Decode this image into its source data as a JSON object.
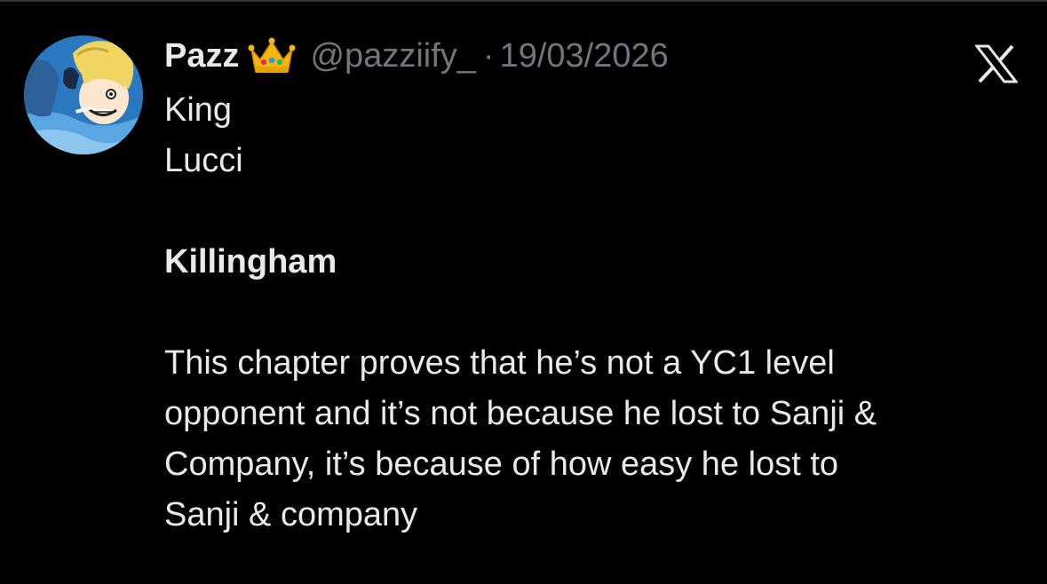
{
  "author": {
    "display_name": "Pazz",
    "badge_icon": "crown-emoji",
    "handle": "@pazziify_",
    "separator": "·",
    "date": "19/03/2026",
    "avatar_desc": "anime-character-avatar"
  },
  "platform": {
    "logo_icon": "x-logo-icon"
  },
  "tweet": {
    "line1": "King",
    "line2": "Lucci",
    "line3": "",
    "line4": "Killingham",
    "line5": "",
    "line6": "This chapter proves that he’s not a YC1 level",
    "line7": "opponent and it’s not because he lost to Sanji &",
    "line8": "Company, it’s because of how easy he lost to",
    "line9": "Sanji & company"
  },
  "colors": {
    "background": "#000000",
    "text_primary": "#e7e9ea",
    "text_secondary": "#71767b"
  }
}
